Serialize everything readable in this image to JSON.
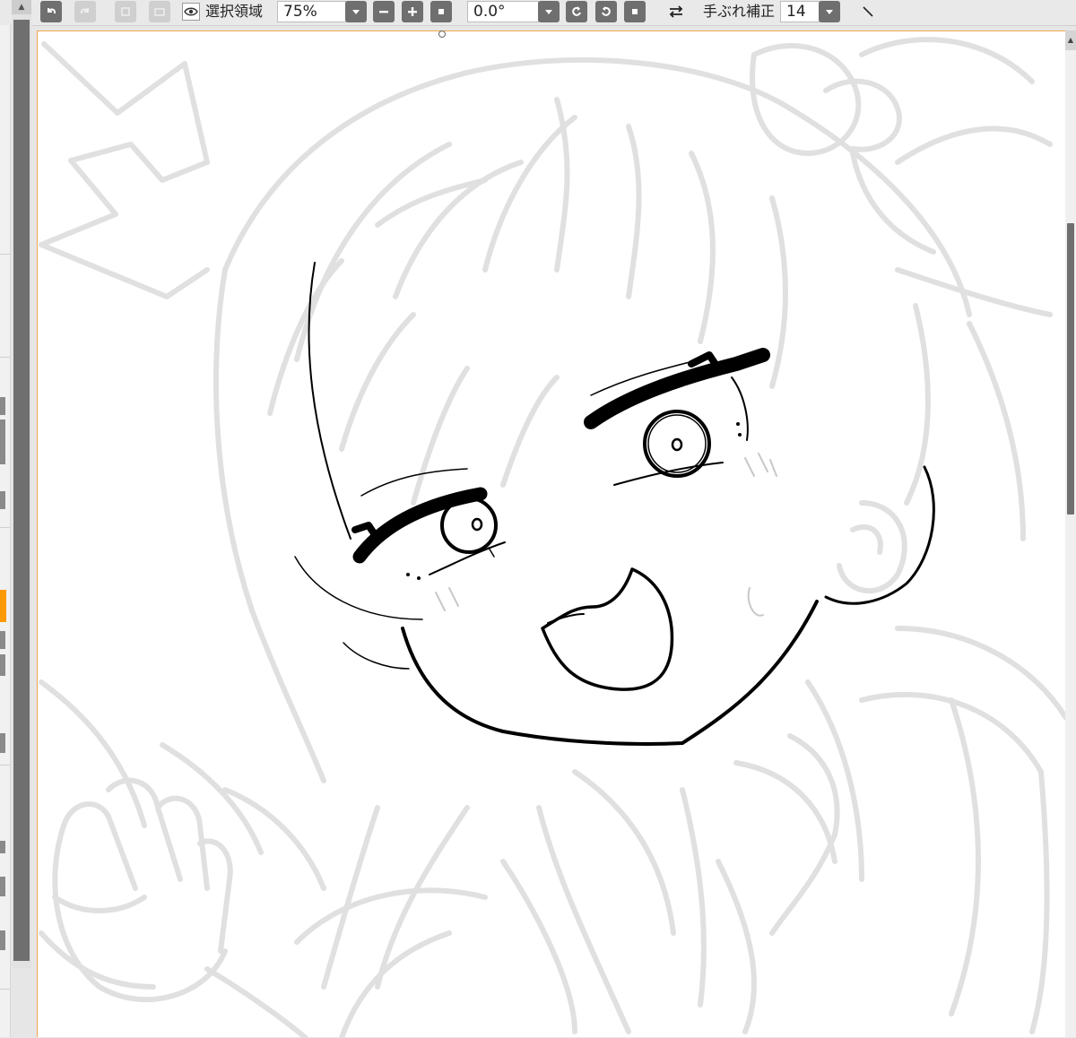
{
  "toolbar": {
    "selection_label": "選択領域",
    "zoom_value": "75%",
    "rotation_value": "0.0°",
    "stabilizer_label": "手ぶれ補正",
    "stabilizer_value": "14",
    "buttons": {
      "undo": "undo-icon",
      "redo": "redo-icon",
      "eye": "eye-icon",
      "zoom_out": "minus-icon",
      "zoom_in": "plus-icon",
      "zoom_reset": "square-icon",
      "rotate_left": "rotate-left-icon",
      "rotate_right": "rotate-right-icon",
      "rotate_reset": "square-icon",
      "flip": "flip-horizontal-icon",
      "pen": "pen-slash-icon"
    }
  },
  "colors": {
    "accent": "#ff9900",
    "canvas_border": "#f3a64a",
    "button_bg": "#6f6f6f",
    "sketch_stroke": "#e0e0e0",
    "ink_stroke": "#000000"
  }
}
